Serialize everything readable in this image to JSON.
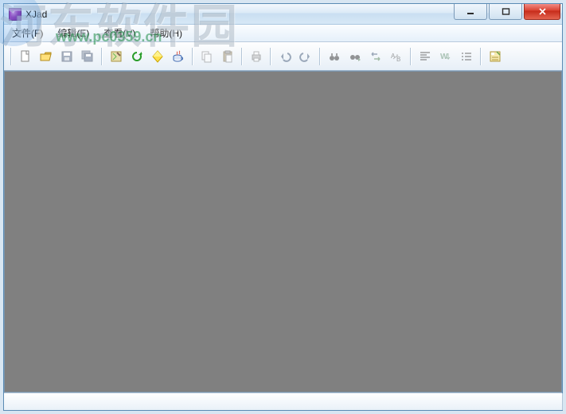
{
  "window": {
    "title": "XJad"
  },
  "menu": {
    "file": "文件(F)",
    "edit": "编辑(E)",
    "view": "查看(V)",
    "help": "帮助(H)"
  },
  "toolbar": {
    "new": "new",
    "open": "open",
    "save": "save",
    "save_all": "save-all",
    "config": "config",
    "refresh": "refresh",
    "jar": "decompile-jar",
    "java": "java",
    "copy": "copy",
    "paste": "paste",
    "print": "print",
    "undo": "undo",
    "redo": "redo",
    "find": "find",
    "find_next": "find-next",
    "replace": "replace",
    "goto": "goto",
    "align_left": "align-left",
    "word_wrap": "word-wrap",
    "list": "list",
    "options": "options"
  },
  "status": {
    "c1": "",
    "c2": "",
    "c3": "",
    "c4": "",
    "c5": ""
  },
  "watermark": {
    "site_name": "河东软件园",
    "site_url": "www.pc0359.cn"
  },
  "colors": {
    "content_bg": "#808080",
    "frame": "#d8e6f2"
  }
}
